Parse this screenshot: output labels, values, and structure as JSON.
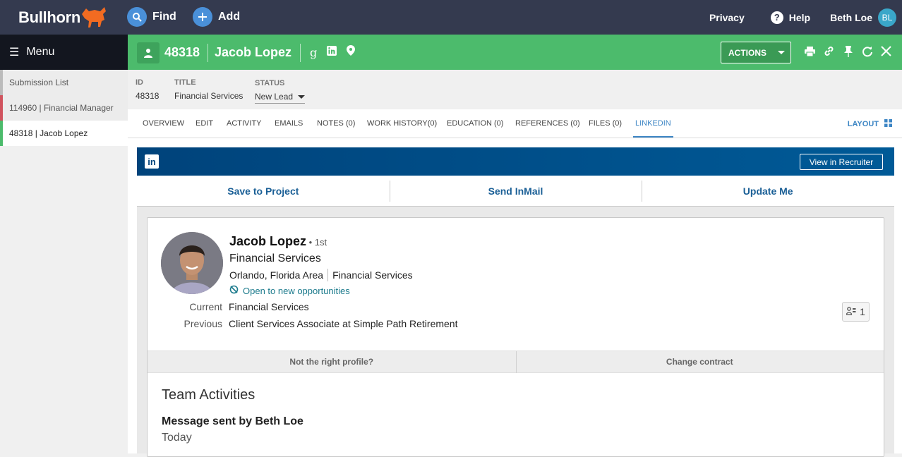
{
  "topbar": {
    "logo": "Bullhorn",
    "find_label": "Find",
    "add_label": "Add",
    "privacy_label": "Privacy",
    "help_label": "Help",
    "user_name": "Beth Loe",
    "user_initials": "BL"
  },
  "sidebar": {
    "menu_label": "Menu",
    "items": [
      {
        "label": "Submission List"
      },
      {
        "label": "114960 | Financial Manager"
      },
      {
        "label": "48318 | Jacob Lopez"
      }
    ]
  },
  "record": {
    "id": "48318",
    "name": "Jacob Lopez",
    "actions_label": "ACTIONS",
    "google_glyph": "g"
  },
  "fields": {
    "id_label": "ID",
    "id_value": "48318",
    "title_label": "TITLE",
    "title_value": "Financial Services",
    "status_label": "STATUS",
    "status_value": "New Lead"
  },
  "tabs": [
    {
      "label": "OVERVIEW"
    },
    {
      "label": "EDIT"
    },
    {
      "label": "ACTIVITY"
    },
    {
      "label": "EMAILS"
    },
    {
      "label": "NOTES (0)"
    },
    {
      "label": "WORK HISTORY(0)"
    },
    {
      "label": "EDUCATION (0)"
    },
    {
      "label": "REFERENCES (0)"
    },
    {
      "label": "FILES (0)"
    },
    {
      "label": "LINKEDIN"
    }
  ],
  "layout_label": "LAYOUT",
  "linkedin": {
    "logo_text": "in",
    "view_recruiter_label": "View in Recruiter",
    "actions": {
      "save_to_project": "Save to Project",
      "send_inmail": "Send InMail",
      "update_me": "Update Me"
    },
    "profile": {
      "name": "Jacob Lopez",
      "degree": " • 1st",
      "headline": "Financial Services",
      "location": "Orlando, Florida Area",
      "industry": "Financial Services",
      "open_label": "Open to new opportunities",
      "current_label": "Current",
      "current_value": "Financial Services",
      "previous_label": "Previous",
      "previous_value": "Client Services Associate at Simple Path Retirement",
      "connections_count": "1",
      "not_right_profile": "Not the right profile?",
      "change_contract": "Change contract"
    },
    "team_activities": {
      "title": "Team Activities",
      "message_title": "Message sent by Beth Loe",
      "message_date": "Today"
    }
  },
  "colors": {
    "topbar": "#343a4f",
    "record_bar": "#4cbb6c",
    "accent_blue": "#3c85c4",
    "linkedin_blue": "#00437b"
  }
}
